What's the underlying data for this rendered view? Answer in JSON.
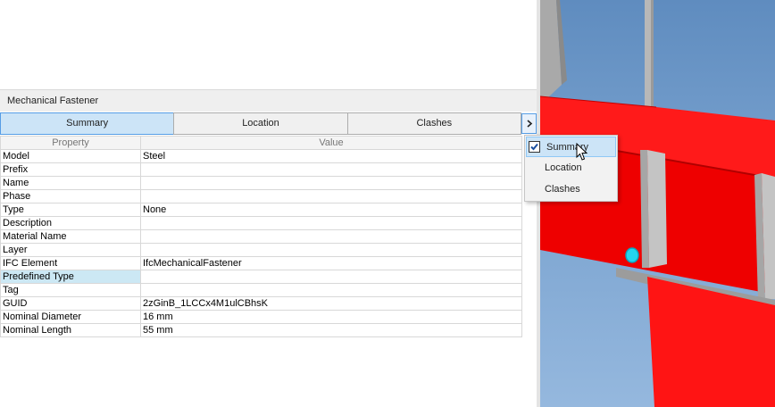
{
  "panel": {
    "title": "Mechanical Fastener"
  },
  "tabs": [
    {
      "label": "Summary",
      "active": true
    },
    {
      "label": "Location",
      "active": false
    },
    {
      "label": "Clashes",
      "active": false
    }
  ],
  "tab_more_icon": "chevron-right-icon",
  "grid": {
    "columns": [
      "Property",
      "Value"
    ],
    "rows": [
      {
        "property": "Model",
        "value": "Steel"
      },
      {
        "property": "Prefix",
        "value": ""
      },
      {
        "property": "Name",
        "value": ""
      },
      {
        "property": "Phase",
        "value": ""
      },
      {
        "property": "Type",
        "value": "None"
      },
      {
        "property": "Description",
        "value": ""
      },
      {
        "property": "Material Name",
        "value": ""
      },
      {
        "property": "Layer",
        "value": ""
      },
      {
        "property": "IFC Element",
        "value": "IfcMechanicalFastener"
      },
      {
        "property": "Predefined Type",
        "value": "",
        "selected": true
      },
      {
        "property": "Tag",
        "value": ""
      },
      {
        "property": "GUID",
        "value": "2zGinB_1LCCx4M1ulCBhsK"
      },
      {
        "property": "Nominal Diameter",
        "value": "16 mm"
      },
      {
        "property": "Nominal Length",
        "value": "55 mm"
      }
    ]
  },
  "dropdown": {
    "items": [
      {
        "label": "Summary",
        "checked": true
      },
      {
        "label": "Location",
        "checked": false
      },
      {
        "label": "Clashes",
        "checked": false
      }
    ]
  },
  "colors": {
    "beam": "#ff0000",
    "sky": "#79a2cf",
    "accent": "#569de5"
  }
}
